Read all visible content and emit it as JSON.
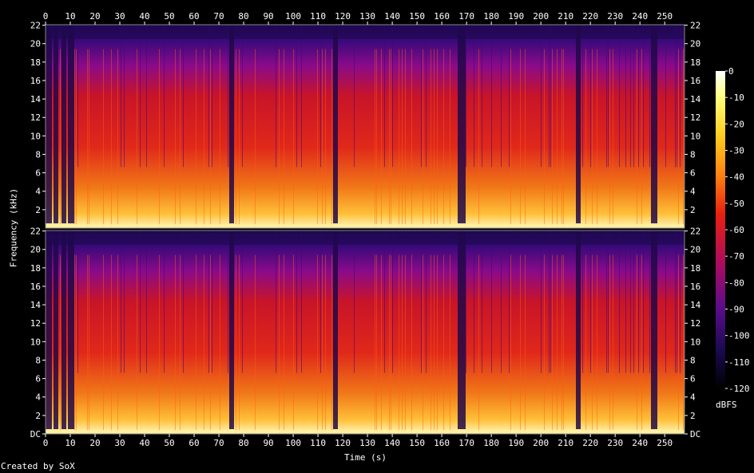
{
  "chart_data": {
    "type": "heatmap",
    "xlabel": "Time (s)",
    "ylabel": "Frequency (kHz)",
    "x_ticks": [
      0,
      10,
      20,
      30,
      40,
      50,
      60,
      70,
      80,
      90,
      100,
      110,
      120,
      130,
      140,
      150,
      160,
      170,
      180,
      190,
      200,
      210,
      220,
      230,
      240,
      250
    ],
    "xlim": [
      0,
      258
    ],
    "y_ticks_top": [
      "22",
      "20",
      "18",
      "16",
      "14",
      "12",
      "10",
      "8",
      "6",
      "4",
      "2"
    ],
    "y_ticks_bottom": [
      "22",
      "20",
      "18",
      "16",
      "14",
      "12",
      "10",
      "8",
      "6",
      "4",
      "2",
      "DC"
    ],
    "y_tick_values_top": [
      22,
      20,
      18,
      16,
      14,
      12,
      10,
      8,
      6,
      4,
      2
    ],
    "y_tick_values_bottom": [
      22,
      20,
      18,
      16,
      14,
      12,
      10,
      8,
      6,
      4,
      2,
      0
    ],
    "ylim": [
      0,
      22.05
    ],
    "channels": 2,
    "colorbar": {
      "label": "dBFS",
      "ticks": [
        "0",
        "-10",
        "-20",
        "-30",
        "-40",
        "-50",
        "-60",
        "-70",
        "-80",
        "-90",
        "-100",
        "-110",
        "-120"
      ],
      "tick_values": [
        0,
        -10,
        -20,
        -30,
        -40,
        -50,
        -60,
        -70,
        -80,
        -90,
        -100,
        -110,
        -120
      ],
      "range": [
        -120,
        0
      ]
    },
    "credit": "Created by SoX",
    "colors": {
      "quiet": "#2b0a5e",
      "mid": "#c8141e",
      "loud": "#ffd23c",
      "peak": "#ffffff"
    }
  }
}
